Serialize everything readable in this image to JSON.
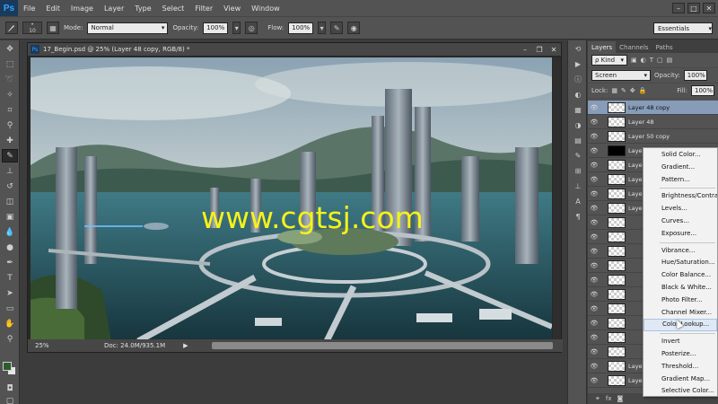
{
  "app": {
    "logo": "Ps",
    "menus": [
      "File",
      "Edit",
      "Image",
      "Layer",
      "Type",
      "Select",
      "Filter",
      "View",
      "Window"
    ],
    "window_controls": [
      "–",
      "□",
      "✕"
    ]
  },
  "options": {
    "brush_size": "10",
    "mode_label": "Mode:",
    "mode_value": "Normal",
    "opacity_label": "Opacity:",
    "opacity_value": "100%",
    "flow_label": "Flow:",
    "flow_value": "100%",
    "workspace": "Essentials"
  },
  "document": {
    "title": "17_Begin.psd @ 25% (Layer 48 copy, RGB/8) *",
    "zoom": "25%",
    "doc_info": "Doc: 24.0M/935.1M",
    "watermark": "www.cgtsj.com",
    "colors": {
      "watermark": "#f5f21a"
    }
  },
  "layers_panel": {
    "tabs": [
      "Layers",
      "Channels",
      "Paths"
    ],
    "kind_label": "ρ Kind",
    "blend_mode": "Screen",
    "opacity_label": "Opacity:",
    "opacity_value": "100%",
    "lock_label": "Lock:",
    "fill_label": "Fill:",
    "fill_value": "100%",
    "layers": [
      {
        "name": "Layer 48 copy",
        "selected": true,
        "thumb": "check"
      },
      {
        "name": "Layer 48",
        "selected": false,
        "thumb": "check"
      },
      {
        "name": "Layer 50 copy",
        "selected": false,
        "thumb": "check"
      },
      {
        "name": "Laye",
        "selected": false,
        "thumb": "black"
      },
      {
        "name": "Laye",
        "selected": false,
        "thumb": "check"
      },
      {
        "name": "Laye",
        "selected": false,
        "thumb": "check"
      },
      {
        "name": "Laye",
        "selected": false,
        "thumb": "check"
      },
      {
        "name": "Laye",
        "selected": false,
        "thumb": "check"
      },
      {
        "name": "",
        "selected": false,
        "thumb": "check"
      },
      {
        "name": "",
        "selected": false,
        "thumb": "check"
      },
      {
        "name": "",
        "selected": false,
        "thumb": "check"
      },
      {
        "name": "",
        "selected": false,
        "thumb": "check"
      },
      {
        "name": "",
        "selected": false,
        "thumb": "check"
      },
      {
        "name": "",
        "selected": false,
        "thumb": "check"
      },
      {
        "name": "",
        "selected": false,
        "thumb": "check"
      },
      {
        "name": "",
        "selected": false,
        "thumb": "check"
      },
      {
        "name": "",
        "selected": false,
        "thumb": "check"
      },
      {
        "name": "",
        "selected": false,
        "thumb": "check"
      },
      {
        "name": "Laye",
        "selected": false,
        "thumb": "check"
      },
      {
        "name": "Laye",
        "selected": false,
        "thumb": "check"
      }
    ],
    "bottom_icons": [
      "link",
      "fx",
      "mask"
    ]
  },
  "adjustment_menu": {
    "group1": [
      "Solid Color...",
      "Gradient...",
      "Pattern..."
    ],
    "group2": [
      "Brightness/Contrast...",
      "Levels...",
      "Curves...",
      "Exposure..."
    ],
    "group3": [
      "Vibrance...",
      "Hue/Saturation...",
      "Color Balance...",
      "Black & White...",
      "Photo Filter...",
      "Channel Mixer...",
      "Color Lookup..."
    ],
    "group4": [
      "Invert",
      "Posterize...",
      "Threshold...",
      "Gradient Map...",
      "Selective Color..."
    ],
    "hover": "Color Lookup..."
  }
}
